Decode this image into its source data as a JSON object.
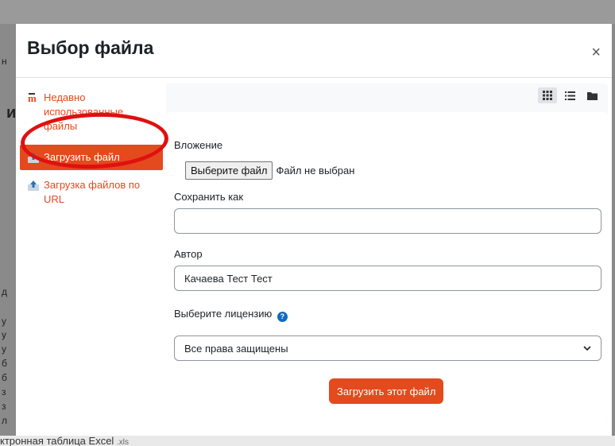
{
  "background": {
    "bottom_text": "ктронная таблица Excel",
    "bottom_ext": ".xls",
    "left_letters": [
      "н",
      "и",
      "д",
      "у",
      "у",
      "у",
      "б",
      "б",
      "з",
      "з",
      "л"
    ]
  },
  "modal": {
    "title": "Выбор файла",
    "close_symbol": "×"
  },
  "sidebar": {
    "items": [
      {
        "label": "Недавно использованные файлы",
        "icon": "recent-files-icon"
      },
      {
        "label": "Загрузить файл",
        "icon": "upload-icon",
        "active": true
      },
      {
        "label": "Загрузка файлов по URL",
        "icon": "url-download-icon"
      }
    ]
  },
  "view_modes": [
    {
      "icon": "grid-view-icon",
      "active": true
    },
    {
      "icon": "list-view-icon",
      "active": false
    },
    {
      "icon": "tree-view-icon",
      "active": false
    }
  ],
  "form": {
    "attachment_label": "Вложение",
    "file_button": "Выберите файл",
    "file_status": "Файл не выбран",
    "save_as_label": "Сохранить как",
    "save_as_value": "",
    "author_label": "Автор",
    "author_value": "Качаева Тест Тест",
    "license_label": "Выберите лицензию",
    "license_value": "Все права защищены",
    "submit_label": "Загрузить этот файл"
  },
  "colors": {
    "accent": "#e34a1e",
    "help": "#0f6cbf",
    "annotation": "#e01010"
  }
}
